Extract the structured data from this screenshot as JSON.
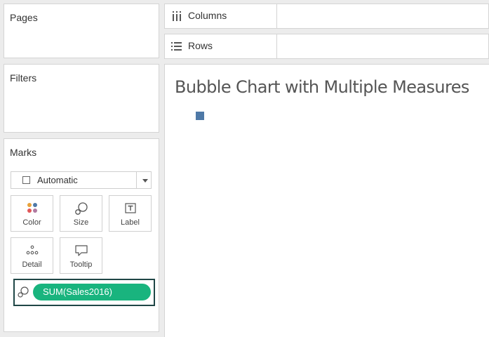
{
  "sidebar": {
    "pages": {
      "title": "Pages"
    },
    "filters": {
      "title": "Filters"
    },
    "marks": {
      "title": "Marks",
      "mark_type": "Automatic",
      "buttons": [
        {
          "label": "Color",
          "icon": "color-dots-icon"
        },
        {
          "label": "Size",
          "icon": "size-icon"
        },
        {
          "label": "Label",
          "icon": "label-icon"
        },
        {
          "label": "Detail",
          "icon": "detail-icon"
        },
        {
          "label": "Tooltip",
          "icon": "tooltip-icon"
        }
      ],
      "pill": {
        "label": "SUM(Sales2016)",
        "icon": "size-icon",
        "color": "#19b47e"
      }
    }
  },
  "shelves": {
    "columns": {
      "label": "Columns",
      "icon": "columns-icon"
    },
    "rows": {
      "label": "Rows",
      "icon": "rows-icon"
    }
  },
  "view": {
    "title": "Bubble Chart with Multiple Measures",
    "mark_color": "#4e79a7"
  }
}
